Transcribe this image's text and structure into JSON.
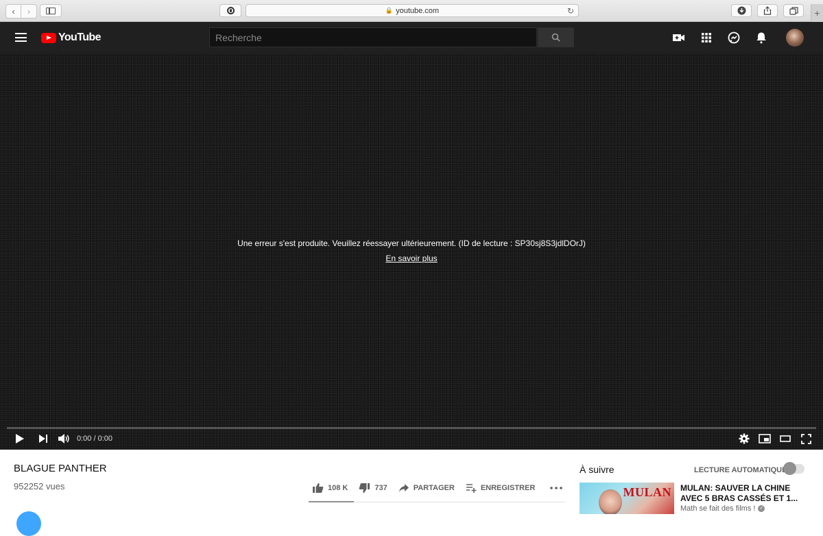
{
  "browser": {
    "url": "youtube.com",
    "back_icon": "chevron-left-icon",
    "forward_icon": "chevron-right-icon",
    "new_tab": "+"
  },
  "header": {
    "logo_text": "YouTube",
    "search_placeholder": "Recherche"
  },
  "player": {
    "error_message": "Une erreur s'est produite. Veuillez réessayer ultérieurement. (ID de lecture : SP30sj8S3jdlDOrJ)",
    "learn_more": "En savoir plus",
    "time": "0:00 / 0:00"
  },
  "video": {
    "title": "BLAGUE PANTHER",
    "views": "952252 vues",
    "likes": "108 K",
    "dislikes": "737",
    "share_label": "PARTAGER",
    "save_label": "ENREGISTRER"
  },
  "sidebar": {
    "up_next_label": "À suivre",
    "autoplay_label": "LECTURE AUTOMATIQUE",
    "autoplay_on": false,
    "next_video": {
      "thumb_text": "MULAN",
      "title": "MULAN: SAUVER LA CHINE AVEC 5 BRAS CASSÉS ET 1...",
      "channel": "Math se fait des films !"
    }
  },
  "colors": {
    "brand_red": "#ff0000",
    "header_bg": "#202020",
    "player_bg": "#161616"
  }
}
